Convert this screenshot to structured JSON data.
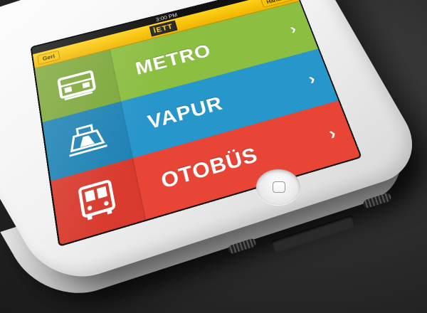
{
  "statusbar": {
    "time": "3:00 PM"
  },
  "navbar": {
    "back_label": "Geri",
    "logo_text": "İETT",
    "right_label": "Haritalar"
  },
  "menu": [
    {
      "label": "METRO",
      "icon": "train-icon",
      "color": "#8cbe42"
    },
    {
      "label": "VAPUR",
      "icon": "ferry-icon",
      "color": "#2796cb"
    },
    {
      "label": "OTOBÜS",
      "icon": "bus-icon",
      "color": "#e84536"
    }
  ],
  "chevron": "›"
}
